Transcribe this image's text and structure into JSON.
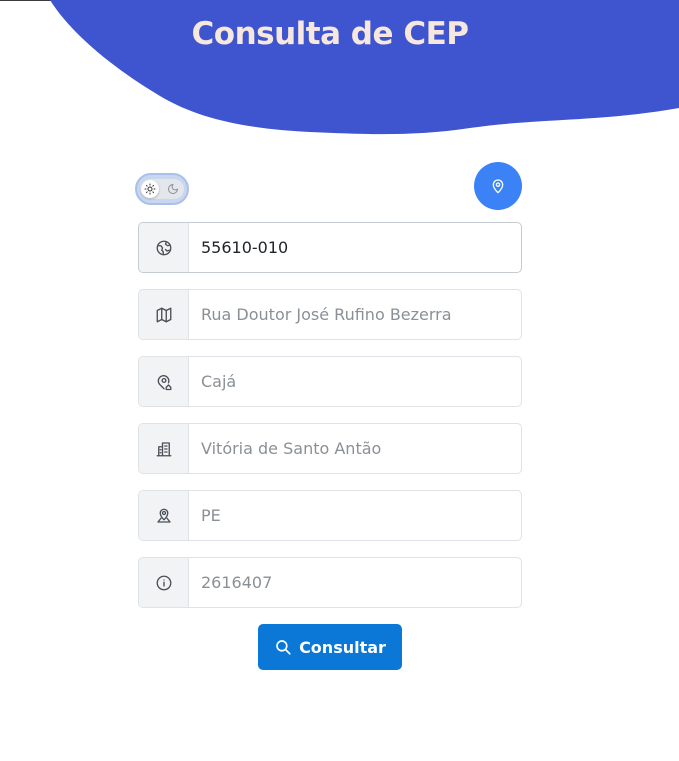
{
  "header": {
    "title": "Consulta de CEP",
    "wave_color": "#3f55cf",
    "title_color": "#f6e7df"
  },
  "controls": {
    "theme_toggle": {
      "state": "light",
      "light_icon": "sun-icon",
      "dark_icon": "moon-icon"
    },
    "locate_button": {
      "icon": "map-pin-icon",
      "color": "#3b82f6"
    }
  },
  "form": {
    "cep": {
      "icon": "globe-icon",
      "value": "55610-010",
      "placeholder": ""
    },
    "street": {
      "icon": "map-icon",
      "value": "",
      "placeholder": "Rua Doutor José Rufino Bezerra"
    },
    "neighborhood": {
      "icon": "map-pin-home-icon",
      "value": "",
      "placeholder": "Cajá"
    },
    "city": {
      "icon": "building-icon",
      "value": "",
      "placeholder": "Vitória de Santo Antão"
    },
    "state": {
      "icon": "map-pin-user-icon",
      "value": "",
      "placeholder": "PE"
    },
    "ibge": {
      "icon": "info-icon",
      "value": "",
      "placeholder": "2616407"
    }
  },
  "submit": {
    "label": "Consultar",
    "icon": "search-icon",
    "color": "#0b78d8"
  }
}
